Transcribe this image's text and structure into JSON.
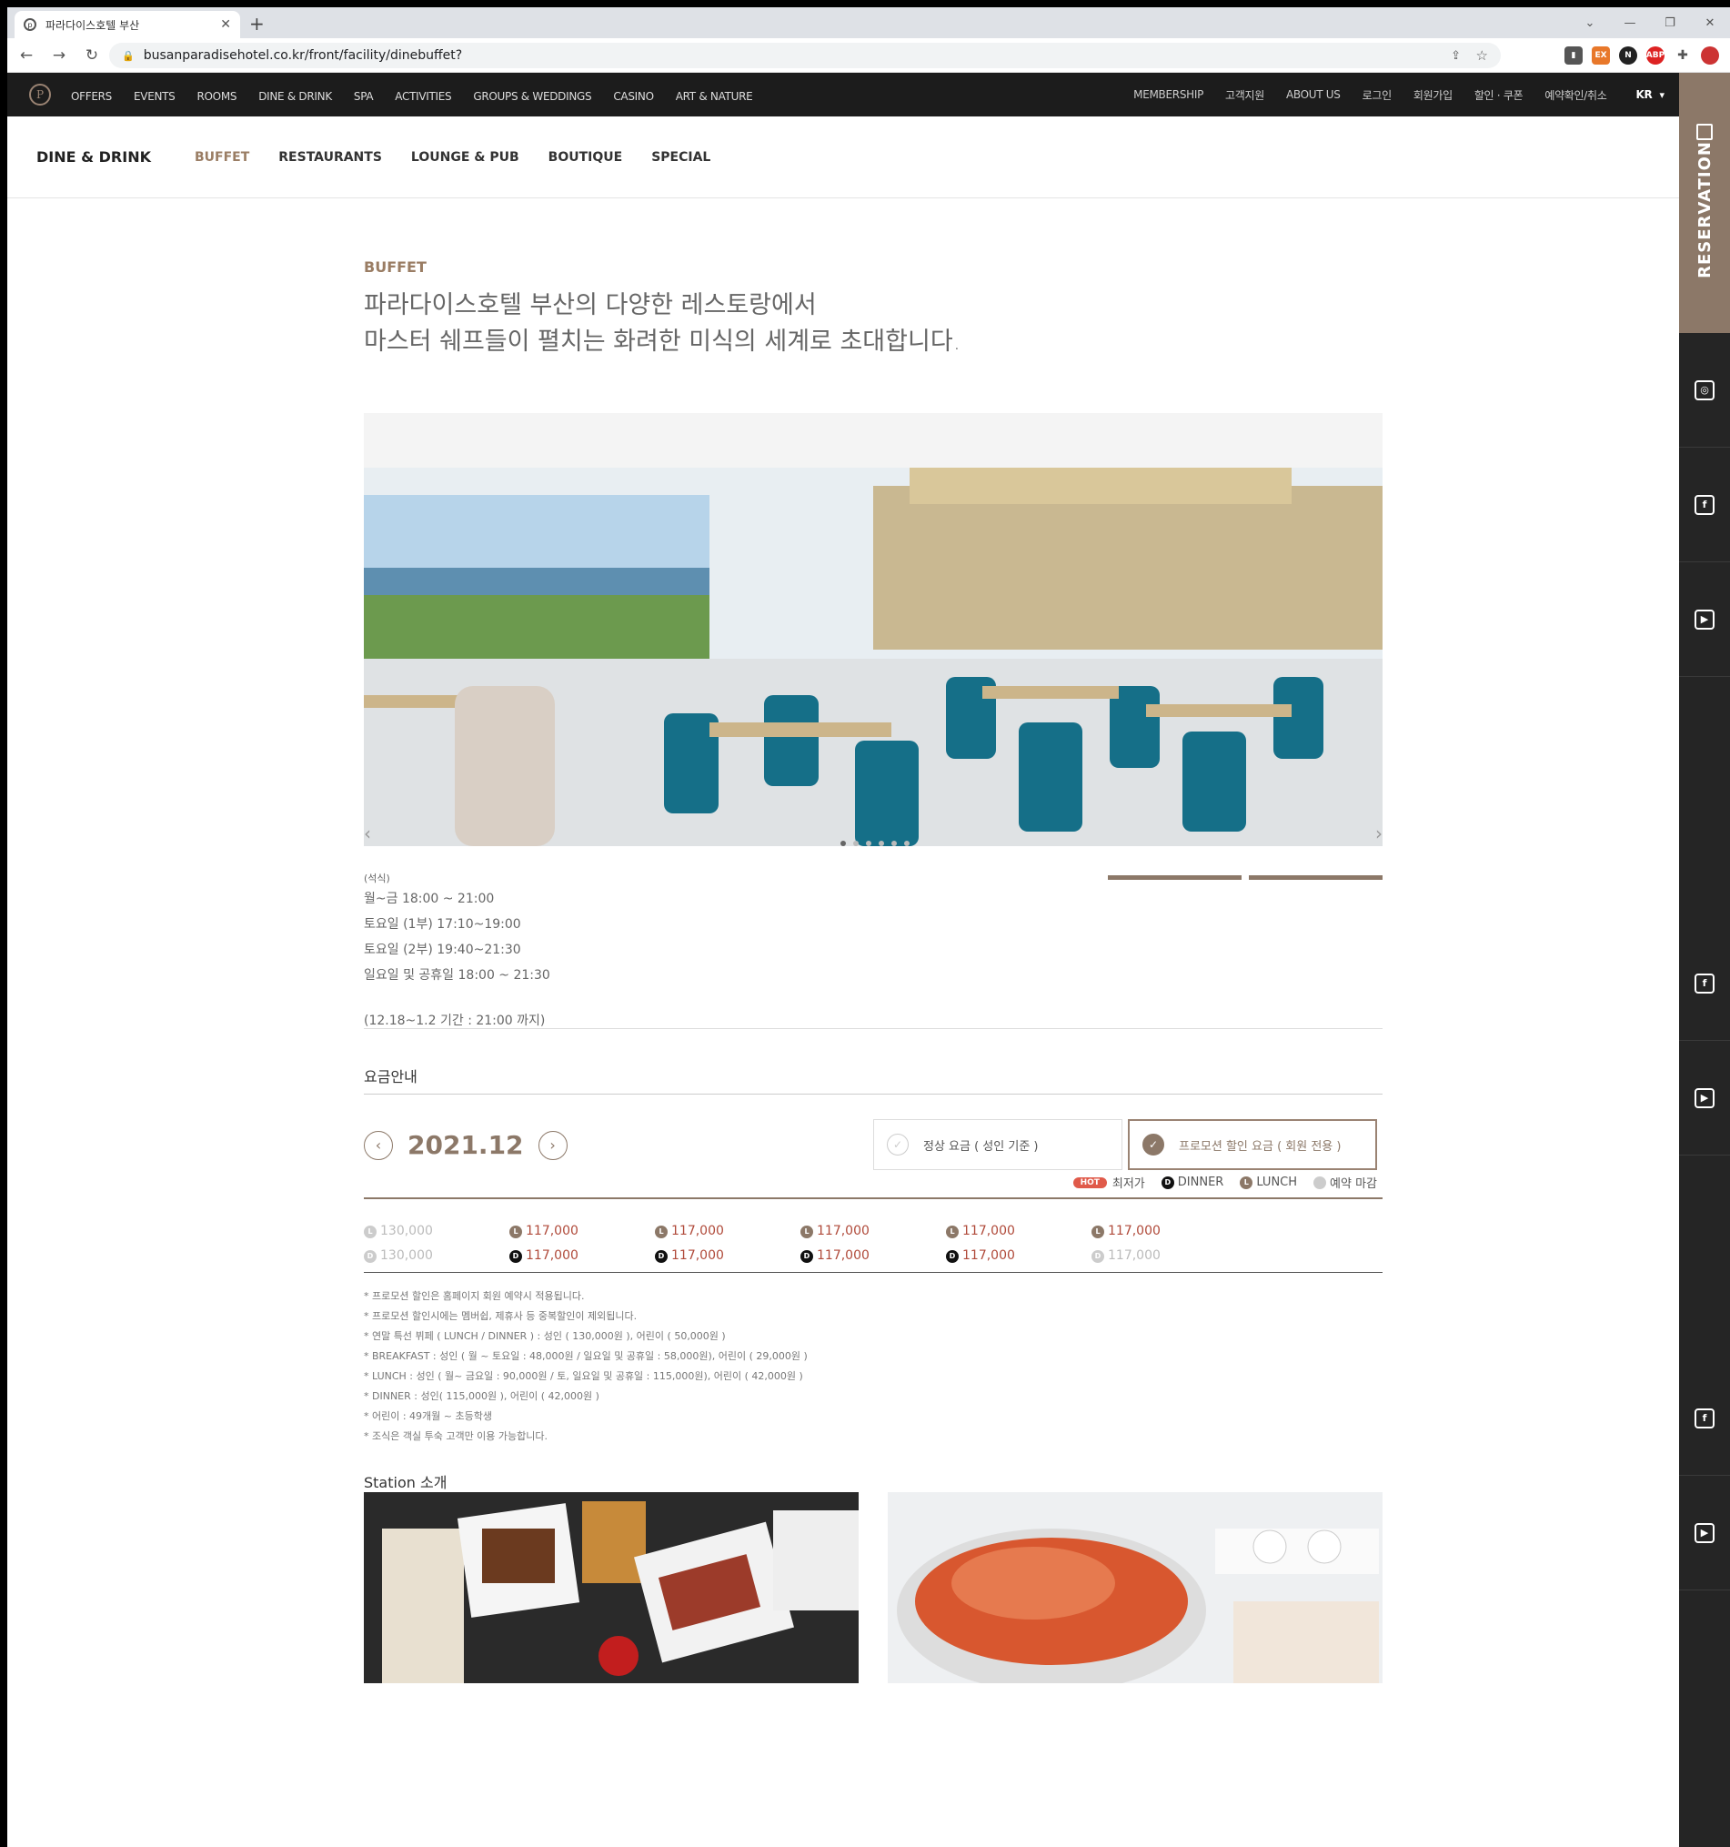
{
  "browser": {
    "tab_title": "파라다이스호텔 부산",
    "url": "busanparadisehotel.co.kr/front/facility/dinebuffet?"
  },
  "gnb": {
    "items": [
      "OFFERS",
      "EVENTS",
      "ROOMS",
      "DINE & DRINK",
      "SPA",
      "ACTIVITIES",
      "GROUPS & WEDDINGS",
      "CASINO",
      "ART & NATURE"
    ],
    "util": [
      "MEMBERSHIP",
      "고객지원",
      "ABOUT US",
      "로그인",
      "회원가입",
      "할인 · 쿠폰",
      "예약확인/취소"
    ],
    "lang": "KR"
  },
  "subnav": {
    "category": "DINE & DRINK",
    "items": [
      "BUFFET",
      "RESTAURANTS",
      "LOUNGE & PUB",
      "BOUTIQUE",
      "SPECIAL"
    ]
  },
  "rail": {
    "reservation": "RESERVATION"
  },
  "page": {
    "eyebrow": "BUFFET",
    "headline_line1": "파라다이스호텔 부산의 다양한 레스토랑에서",
    "headline_line2": "마스터 쉐프들이 펼치는 화려한 미식의 세계로 초대합니다."
  },
  "hours": {
    "label": "(석식)",
    "lines": [
      "월~금 18:00 ~ 21:00",
      "토요일 (1부) 17:10~19:00",
      "토요일 (2부) 19:40~21:30",
      "일요일 및 공휴일 18:00 ~ 21:30"
    ],
    "note": "(12.18~1.2 기간 : 21:00 까지)"
  },
  "fees": {
    "title": "요금안내",
    "month": "2021.12",
    "tab_regular": "정상 요금 ( 성인 기준 )",
    "tab_promo": "프로모션 할인 요금 ( 회원 전용 )",
    "legend": {
      "hot": "HOT",
      "lowest": "최저가",
      "dinner": "DINNER",
      "lunch": "LUNCH",
      "closed": "예약 마감"
    },
    "columns": [
      {
        "lunch": "130,000",
        "dinner": "130,000"
      },
      {
        "lunch": "117,000",
        "dinner": "117,000"
      },
      {
        "lunch": "117,000",
        "dinner": "117,000"
      },
      {
        "lunch": "117,000",
        "dinner": "117,000"
      },
      {
        "lunch": "117,000",
        "dinner": "117,000"
      },
      {
        "lunch": "117,000",
        "dinner": "117,000"
      }
    ],
    "notes": [
      "* 프로모션 할인은 홈페이지 회원 예약시 적용됩니다.",
      "* 프로모션 할인시에는 멤버쉽, 제휴사 등 중복할인이 제외됩니다.",
      "* 연말 특선 뷔페 ( LUNCH / DINNER ) : 성인 ( 130,000원 ), 어린이 ( 50,000원 )",
      "* BREAKFAST : 성인 ( 월 ~ 토요일 : 48,000원 / 일요일 및 공휴일 : 58,000원), 어린이 ( 29,000원 )",
      "* LUNCH : 성인 ( 월~ 금요일 : 90,000원 / 토, 일요일 및 공휴일 : 115,000원), 어린이 ( 42,000원 )",
      "* DINNER : 성인( 115,000원 ), 어린이 ( 42,000원 )",
      "* 어린이 : 49개월 ~ 초등학생",
      "* 조식은 객실 투숙 고객만 이용 가능합니다."
    ]
  },
  "station": {
    "title": "Station 소개"
  }
}
